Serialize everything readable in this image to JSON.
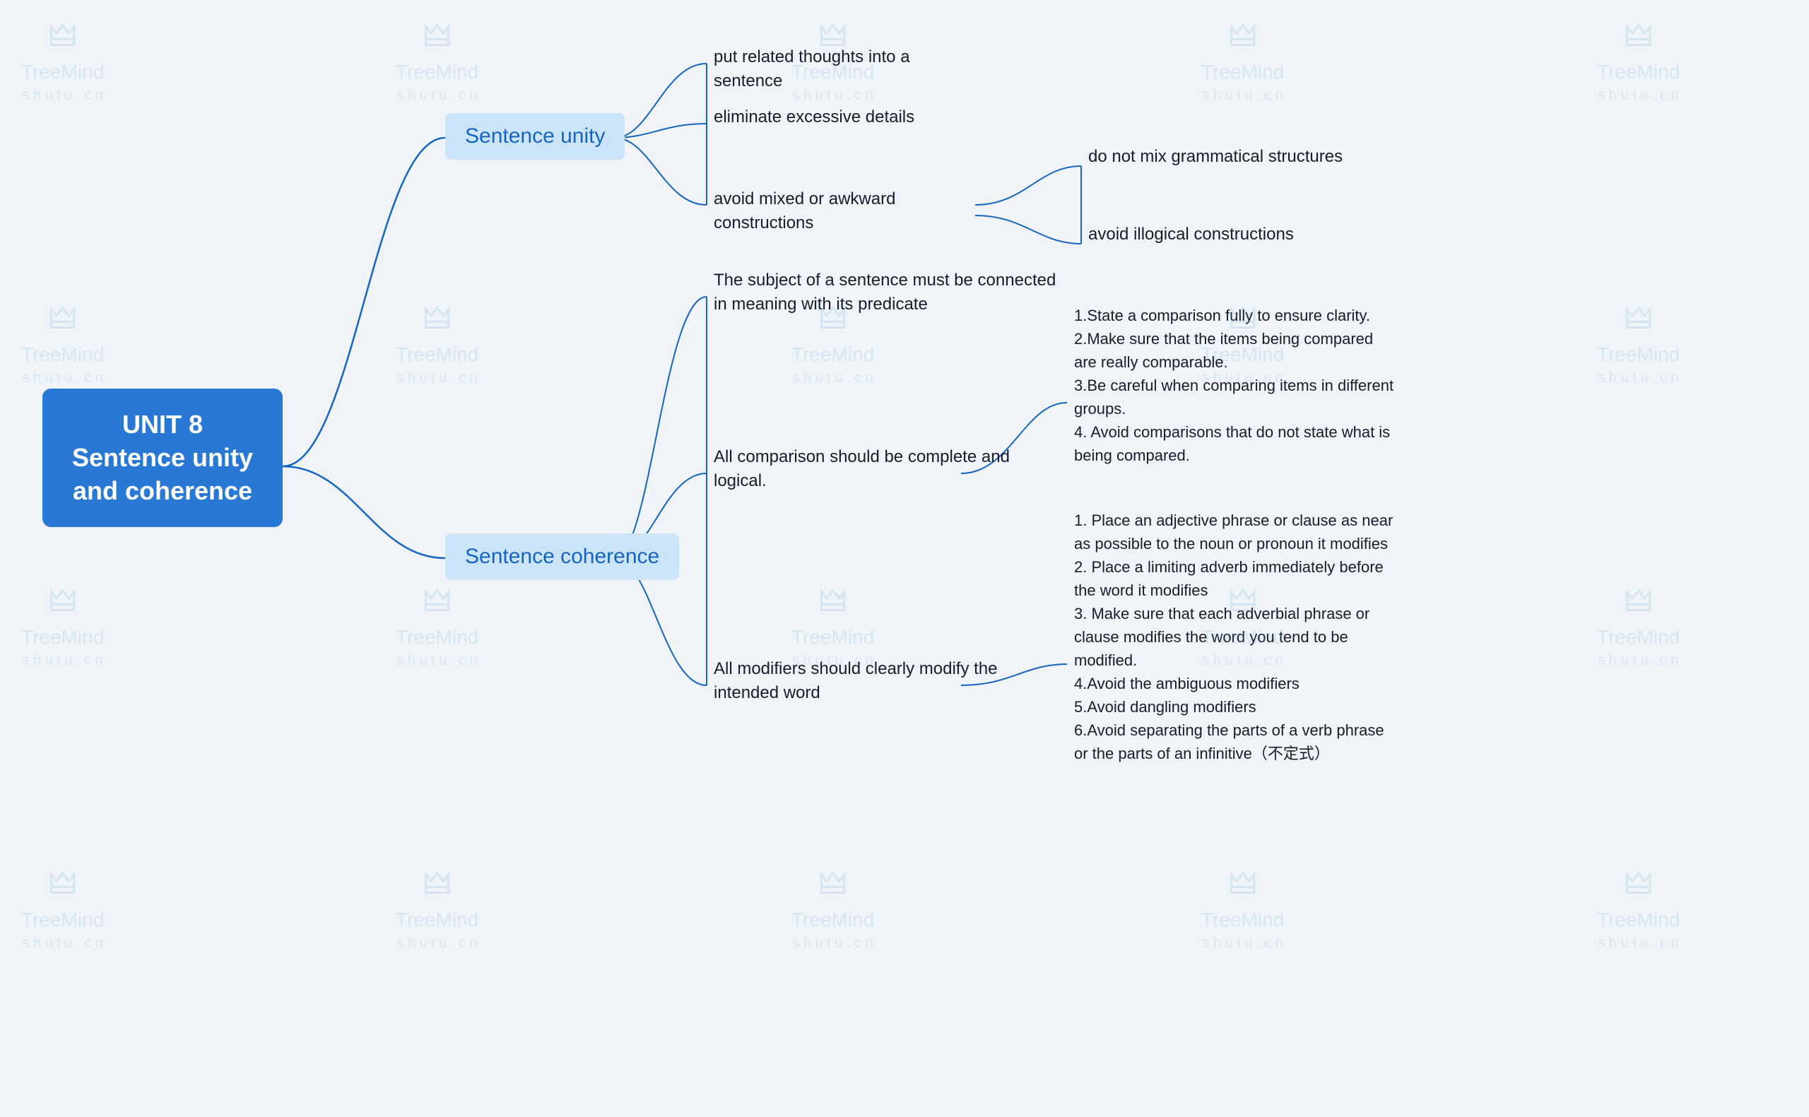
{
  "watermarks": [
    {
      "line1": "TreeMind",
      "line2": "s h u t u . c n"
    }
  ],
  "root": {
    "label": "UNIT 8 Sentence unity and coherence"
  },
  "level1": {
    "sentence_unity": {
      "label": "Sentence unity"
    },
    "sentence_coherence": {
      "label": "Sentence coherence"
    }
  },
  "unity_leaves": {
    "leaf1": "put related thoughts into a sentence",
    "leaf2": "eliminate excessive details",
    "leaf3": "avoid mixed or awkward constructions"
  },
  "awkward_children": {
    "child1": "do not mix grammatical structures",
    "child2": "avoid illogical constructions"
  },
  "coherence_leaves": {
    "leaf1": "The subject of a sentence must be connected in meaning with its predicate",
    "leaf2": "All comparison should be complete and logical.",
    "leaf3": "All modifiers should clearly modify the intended word"
  },
  "comparison_details": "1.State a comparison fully to ensure clarity.\n2.Make sure that the items being compared are really comparable.\n3.Be careful when comparing items in different groups.\n4. Avoid comparisons that do not state what is being compared.",
  "modifiers_details": "1. Place an adjective phrase or clause as near as possible to the noun or pronoun it modifies\n2. Place a limiting adverb immediately before the word it modifies\n3. Make sure that each adverbial phrase or clause modifies the word you tend to be modified.\n4.Avoid the ambiguous modifiers\n5.Avoid dangling modifiers\n6.Avoid separating the parts of a verb phrase or the parts of an infinitive（不定式）"
}
